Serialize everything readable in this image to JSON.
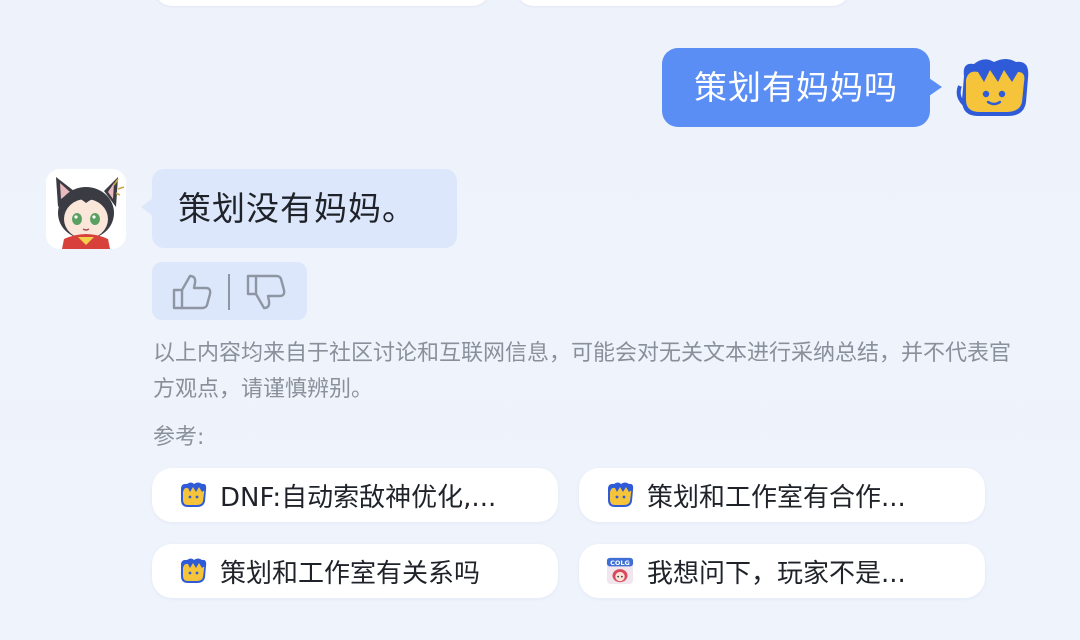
{
  "colors": {
    "user_bubble": "#5b8ef5",
    "bot_bubble": "#dde7fb",
    "muted_text": "#8a909b",
    "card_bg": "#ffffff"
  },
  "conversation": {
    "user_message": "策划有妈妈吗",
    "bot_message": "策划没有妈妈。"
  },
  "feedback": {
    "like_icon": "thumbs-up-icon",
    "dislike_icon": "thumbs-down-icon"
  },
  "disclaimer": "以上内容均来自于社区讨论和互联网信息，可能会对无关文本进行采纳总结，并不代表官方观点，请谨慎辨别。",
  "references": {
    "label": "参考:",
    "items": [
      {
        "title": "DNF:自动索敌神优化,...",
        "icon": "mascot-icon"
      },
      {
        "title": "策划和工作室有合作...",
        "icon": "mascot-icon"
      },
      {
        "title": "策划和工作室有关系吗",
        "icon": "mascot-icon"
      },
      {
        "title": "我想问下，玩家不是...",
        "icon": "colg-logo-icon"
      }
    ]
  }
}
